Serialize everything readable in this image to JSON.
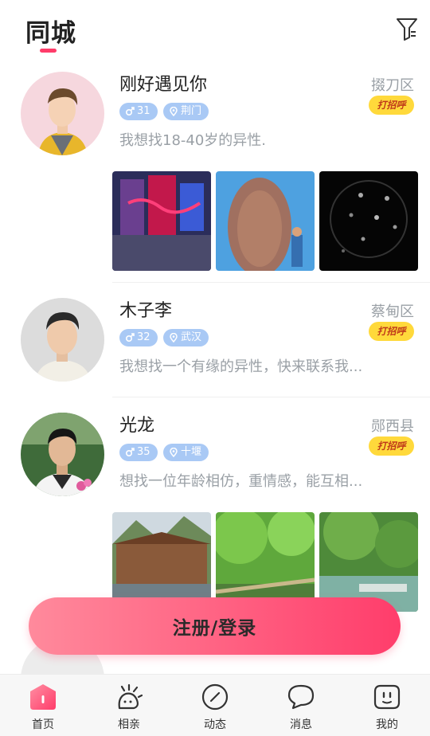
{
  "header": {
    "title": "同城"
  },
  "users": [
    {
      "name": "刚好遇见你",
      "age": "31",
      "city": "荆门",
      "district": "掇刀区",
      "greet": "打招呼",
      "intro": "我想找18-40岁的异性."
    },
    {
      "name": "木子李",
      "age": "32",
      "city": "武汉",
      "district": "蔡甸区",
      "greet": "打招呼",
      "intro": "我想找一个有缘的异性，快来联系我..."
    },
    {
      "name": "光龙",
      "age": "35",
      "city": "十堰",
      "district": "郧西县",
      "greet": "打招呼",
      "intro": "想找一位年龄相仿，重情感，能互相..."
    }
  ],
  "register": {
    "label": "注册/登录"
  },
  "tabbar": [
    {
      "label": "首页",
      "icon": "home-icon"
    },
    {
      "label": "相亲",
      "icon": "matchmaking-icon"
    },
    {
      "label": "动态",
      "icon": "moments-icon"
    },
    {
      "label": "消息",
      "icon": "message-icon"
    },
    {
      "label": "我的",
      "icon": "profile-icon"
    }
  ],
  "colors": {
    "accent": "#ff3c6a",
    "tag": "#a9c9f5",
    "greet": "#ffd93b"
  }
}
